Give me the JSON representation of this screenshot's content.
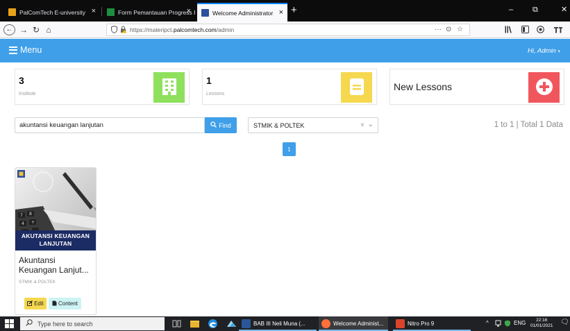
{
  "browser": {
    "tabs": [
      {
        "title": "PalComTech E-university",
        "close": "×"
      },
      {
        "title": "Form Pemantauan Progress Pe",
        "close": "×"
      },
      {
        "title": "Welcome Administrator",
        "close": "×"
      }
    ],
    "new_tab": "+",
    "window_controls": {
      "minimize": "–",
      "maximize": "⧉",
      "close": "✕"
    },
    "nav": {
      "back": "←",
      "forward": "→",
      "reload": "↻",
      "home": "⌂"
    },
    "url": {
      "prefix": "https://materipct.",
      "domain": "palcomtech.com",
      "path": "/admin"
    },
    "url_actions": {
      "more": "···",
      "pocket": "⊙",
      "bookmark": "☆"
    },
    "toolbar": {
      "library": "𝄃𝄃\\",
      "sidebar": "▢",
      "extension": "◉",
      "account": "𝖙"
    }
  },
  "header": {
    "menu_label": "Menu",
    "user_label": "Hi, Admin",
    "user_caret": "▾",
    "brand_color": "#3f9fe8"
  },
  "stats": [
    {
      "value": "3",
      "label": "Institute",
      "icon": "building-icon",
      "color": "#8fe05d"
    },
    {
      "value": "1",
      "label": "Lessons",
      "icon": "book-icon",
      "color": "#f6d84f"
    },
    {
      "title": "New Lessons",
      "icon": "plus-circle-icon",
      "color": "#f0575d"
    }
  ],
  "search": {
    "value": "akuntansi keuangan lanjutan",
    "find_label": "Find",
    "filter_value": "STMIK & POLTEK",
    "clear": "×",
    "caret": "⌄",
    "result_text": "1 to 1 | Total 1 Data"
  },
  "pagination": {
    "current_page": "1"
  },
  "lessons": [
    {
      "banner_line1": "AKUTANSI KEUANGAN",
      "banner_line2": "LANJUTAN",
      "title": "Akuntansi Keuangan Lanjut...",
      "category": "STMIK & POLTEK",
      "edit_label": "Edit",
      "content_label": "Content"
    }
  ],
  "taskbar": {
    "search_placeholder": "Type here to search",
    "apps": [
      {
        "label": "BAB III Neli Muna (...",
        "color": "#2b579a"
      },
      {
        "label": "Welcome Administ...",
        "color": "#ff7139"
      },
      {
        "label": "Nitro Pro 9",
        "color": "#d9452a"
      }
    ],
    "tray_arrow": "^",
    "language": "ENG",
    "time": "22:16",
    "date": "01/01/2021",
    "notifications": "🗨"
  }
}
